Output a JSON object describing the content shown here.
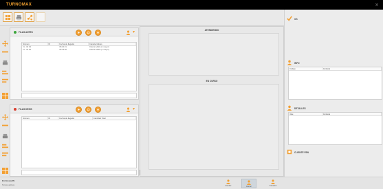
{
  "app": {
    "brand": "TURNOMAX",
    "close": "×"
  },
  "colors": {
    "accent": "#f2a034",
    "titlebar": "#000000",
    "green": "#3aa53a",
    "red": "#d93c2e"
  },
  "toolbar": {
    "icons": [
      "grid-icon",
      "print-icon",
      "network-icon",
      "blank-icon"
    ]
  },
  "panel_top": {
    "title": "FILAS ANTES",
    "status": "green",
    "columns": [
      "Número",
      "M",
      "Fecha de llegada",
      "Características"
    ],
    "rows": [
      [
        "J1 - 02 04",
        "",
        "06:40:21",
        "Cliente Adulto (1 mayor)"
      ],
      [
        "J1 - 02 05",
        "",
        "06:44:55",
        "Cliente Adulto (1 mayor)"
      ]
    ]
  },
  "panel_bottom": {
    "title": "FILAS DESIS",
    "status": "red",
    "columns": [
      "Número",
      "M",
      "Fecha de llegada",
      "Cantidad Total"
    ],
    "rows": []
  },
  "center": {
    "sections": [
      "ATENDIENDO",
      "EN CURSO"
    ]
  },
  "right": {
    "sections": [
      {
        "title": "OK",
        "columns": []
      },
      {
        "title": "INFO",
        "columns": [
          "Código",
          "Entrada"
        ]
      },
      {
        "title": "DETALLES",
        "columns": [
          "Vale",
          "Entrada"
        ]
      },
      {
        "title": "CLIENTE FEN",
        "columns": []
      }
    ]
  },
  "footer": {
    "status_title": "En línea (off)",
    "status_sub": "Turnos activos",
    "buttons": [
      "Atender",
      "Llamar",
      "Transferir"
    ]
  }
}
